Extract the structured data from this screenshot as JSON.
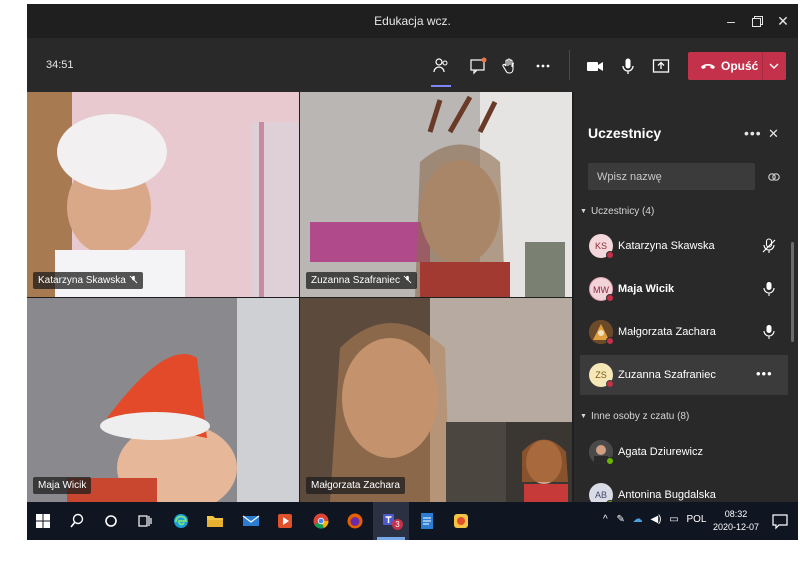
{
  "window": {
    "title": "Edukacja wcz.",
    "controls": [
      "minimize-icon",
      "maximize-icon",
      "close-icon"
    ]
  },
  "call": {
    "timer": "34:51",
    "leave_label": "Opuść",
    "buttons": [
      "participants-icon",
      "chat-icon",
      "raise-hand-icon",
      "more-icon",
      "camera-icon",
      "microphone-icon",
      "share-screen-icon"
    ]
  },
  "videos": [
    {
      "name": "Katarzyna Skawska",
      "mic": "muted"
    },
    {
      "name": "Zuzanna Szafraniec",
      "mic": "muted"
    },
    {
      "name": "Maja Wicik",
      "mic": "none"
    },
    {
      "name": "Małgorzata Zachara",
      "mic": "none"
    }
  ],
  "panel": {
    "title": "Uczestnicy",
    "search_placeholder": "Wpisz nazwę",
    "section1": "Uczestnicy (4)",
    "participants": [
      {
        "initials": "KS",
        "name": "Katarzyna Skawska",
        "avatar_bg": "#f4d7da",
        "avatar_fg": "#8a2a3a",
        "status": "#c4314b",
        "mic": "muted"
      },
      {
        "initials": "MW",
        "name": "Maja Wicik",
        "avatar_bg": "#f2d4d8",
        "avatar_fg": "#8a2a3a",
        "status": "#c4314b",
        "mic": "on"
      },
      {
        "initials": "",
        "name": "Małgorzata Zachara",
        "avatar_bg": "#8a5a2a",
        "avatar_fg": "#ffffff",
        "status": "#c4314b",
        "mic": "on"
      },
      {
        "initials": "ZS",
        "name": "Zuzanna Szafraniec",
        "avatar_bg": "#f6e7b8",
        "avatar_fg": "#7a5a10",
        "status": "#c4314b",
        "mic": "more"
      }
    ],
    "section2": "Inne osoby z czatu (8)",
    "others": [
      {
        "initials": "",
        "name": "Agata Dziurewicz",
        "avatar_bg": "#6a6a6a",
        "avatar_fg": "#ffffff",
        "status": "#6bb700"
      },
      {
        "initials": "AB",
        "name": "Antonina Bugdalska",
        "avatar_bg": "#d9dbe6",
        "avatar_fg": "#444a6a",
        "status": "#6bb700"
      }
    ]
  },
  "taskbar": {
    "language": "POL",
    "time": "08:32",
    "date": "2020-12-07",
    "teams_badge": "3"
  }
}
